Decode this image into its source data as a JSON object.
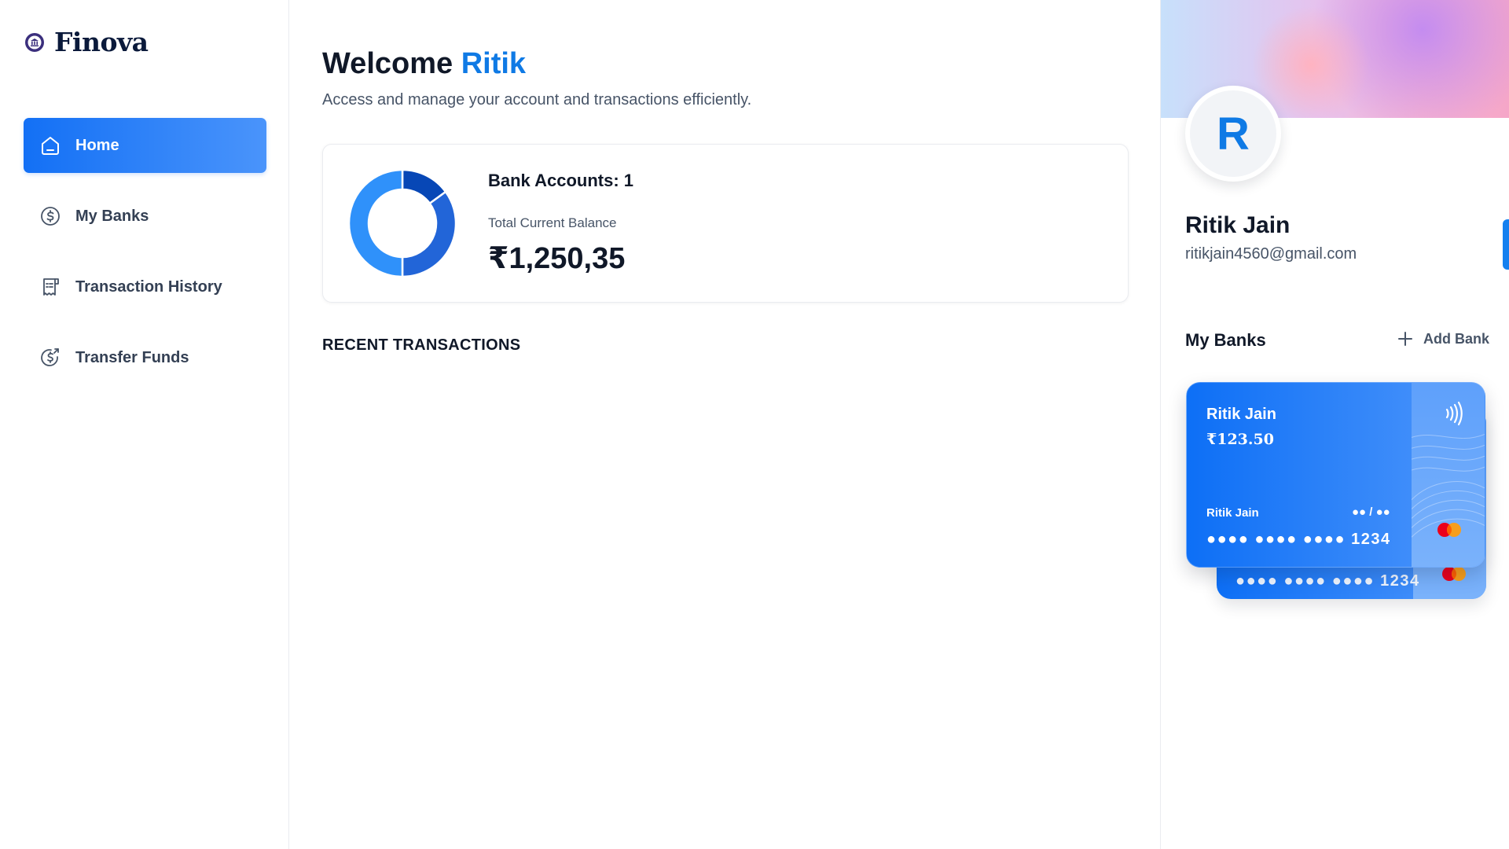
{
  "brand": {
    "name": "Finova",
    "logo_icon": "bank-icon"
  },
  "sidebar": {
    "items": [
      {
        "label": "Home",
        "icon": "home-icon",
        "active": true
      },
      {
        "label": "My Banks",
        "icon": "dollar-circle-icon",
        "active": false
      },
      {
        "label": "Transaction History",
        "icon": "receipt-icon",
        "active": false
      },
      {
        "label": "Transfer Funds",
        "icon": "money-send-icon",
        "active": false
      }
    ]
  },
  "header": {
    "welcome_prefix": "Welcome",
    "user_first_name": "Ritik",
    "subtitle": "Access and manage your account and transactions efficiently."
  },
  "balance_card": {
    "bank_accounts_label": "Bank Accounts: 1",
    "total_label": "Total Current Balance",
    "total_value": "₹1,250,35"
  },
  "chart_data": {
    "type": "pie",
    "variant": "donut",
    "values": [
      15,
      35,
      50
    ],
    "colors": [
      "#0747b6",
      "#2265d8",
      "#2f91fa"
    ]
  },
  "recent_transactions": {
    "title": "RECENT TRANSACTIONS"
  },
  "profile": {
    "initial": "R",
    "name": "Ritik Jain",
    "email": "ritikjain4560@gmail.com"
  },
  "banks_panel": {
    "title": "My Banks",
    "add_label": "Add Bank"
  },
  "cards": {
    "front": {
      "holder": "Ritik Jain",
      "balance": "₹123.50",
      "holder_small": "Ritik Jain",
      "expiry": "●● / ●●",
      "number": "●●●● ●●●● ●●●● 1234"
    },
    "back": {
      "number": "●●●● ●●●● ●●●● 1234"
    }
  },
  "colors": {
    "primary": "#0f7ae5",
    "active_nav_start": "#1370f5",
    "active_nav_end": "#4a94fb",
    "text_dark": "#101828",
    "text_muted": "#475467"
  }
}
